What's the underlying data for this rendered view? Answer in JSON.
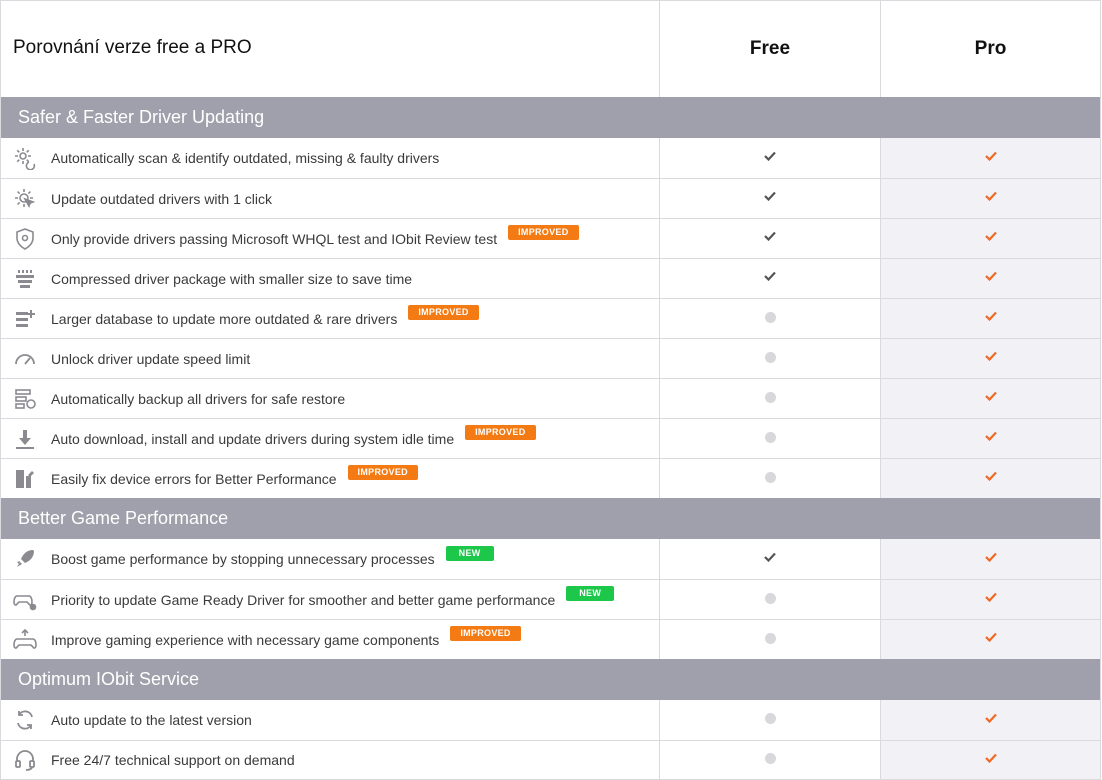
{
  "header": {
    "title": "Porovnání verze free a PRO",
    "free": "Free",
    "pro": "Pro"
  },
  "colors": {
    "section_bg": "#9fa0ab",
    "pro_bg": "#f2f2f6",
    "check_pro": "#f26722",
    "check_free": "#555555",
    "badge_improved": "#f47a13",
    "badge_new": "#1cc74a"
  },
  "sections": [
    {
      "title": "Safer & Faster Driver Updating",
      "rows": [
        {
          "icon": "gear-scan-icon",
          "label": "Automatically scan & identify outdated, missing & faulty drivers",
          "badge": "",
          "free": "check",
          "pro": "check"
        },
        {
          "icon": "gear-click-icon",
          "label": "Update outdated drivers with 1 click",
          "badge": "",
          "free": "check",
          "pro": "check"
        },
        {
          "icon": "shield-icon",
          "label": "Only provide drivers passing Microsoft WHQL test and IObit Review test",
          "badge": "IMPROVED",
          "free": "check",
          "pro": "check"
        },
        {
          "icon": "package-icon",
          "label": "Compressed driver package with smaller size to save time",
          "badge": "",
          "free": "check",
          "pro": "check"
        },
        {
          "icon": "database-plus-icon",
          "label": "Larger database to update more outdated & rare drivers",
          "badge": "IMPROVED",
          "free": "none",
          "pro": "check"
        },
        {
          "icon": "speedometer-icon",
          "label": "Unlock driver update speed limit",
          "badge": "",
          "free": "none",
          "pro": "check"
        },
        {
          "icon": "backup-icon",
          "label": "Automatically backup all drivers for safe restore",
          "badge": "",
          "free": "none",
          "pro": "check"
        },
        {
          "icon": "download-icon",
          "label": "Auto download, install and update drivers during system idle time",
          "badge": "IMPROVED",
          "free": "none",
          "pro": "check"
        },
        {
          "icon": "device-fix-icon",
          "label": "Easily fix device errors for Better Performance",
          "badge": "IMPROVED",
          "free": "none",
          "pro": "check"
        }
      ]
    },
    {
      "title": "Better Game Performance",
      "rows": [
        {
          "icon": "rocket-icon",
          "label": "Boost game performance by stopping unnecessary processes",
          "badge": "NEW",
          "free": "check",
          "pro": "check"
        },
        {
          "icon": "gamepad-gear-icon",
          "label": "Priority to update Game Ready Driver for smoother and better game performance",
          "badge": "NEW",
          "free": "none",
          "pro": "check"
        },
        {
          "icon": "gamepad-up-icon",
          "label": "Improve gaming experience with necessary game components",
          "badge": "IMPROVED",
          "free": "none",
          "pro": "check"
        }
      ]
    },
    {
      "title": "Optimum IObit Service",
      "rows": [
        {
          "icon": "refresh-icon",
          "label": "Auto update to the latest version",
          "badge": "",
          "free": "none",
          "pro": "check"
        },
        {
          "icon": "headset-icon",
          "label": "Free 24/7 technical support on demand",
          "badge": "",
          "free": "none",
          "pro": "check"
        }
      ]
    }
  ]
}
